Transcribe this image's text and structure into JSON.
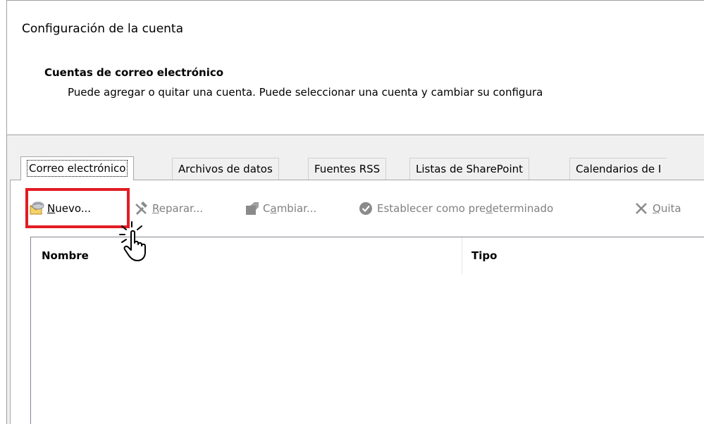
{
  "window": {
    "title": "Configuración de la cuenta"
  },
  "header": {
    "section_title": "Cuentas de correo electrónico",
    "description": "Puede agregar o quitar una cuenta. Puede seleccionar una cuenta y cambiar su configura"
  },
  "tabs": [
    {
      "label": "Correo electrónico",
      "active": true
    },
    {
      "label": "Archivos de datos"
    },
    {
      "label": "Fuentes RSS"
    },
    {
      "label": "Listas de SharePoint"
    },
    {
      "label": "Calendarios de I"
    }
  ],
  "toolbar": {
    "new": {
      "pre": "",
      "ul": "N",
      "post": "uevo...",
      "icon": "new-account-icon"
    },
    "repair": {
      "pre": "",
      "ul": "R",
      "post": "eparar...",
      "icon": "repair-tools-icon"
    },
    "change": {
      "pre": "C",
      "ul": "a",
      "post": "mbiar...",
      "icon": "change-icon"
    },
    "default": {
      "pre": "Establecer como pre",
      "ul": "d",
      "post": "eterminado",
      "icon": "checkmark-circle-icon"
    },
    "remove": {
      "pre": "",
      "ul": "Q",
      "post": "uita",
      "icon": "close-x-icon"
    }
  },
  "list": {
    "columns": [
      "Nombre",
      "Tipo"
    ],
    "rows": []
  },
  "colors": {
    "highlight": "#e31b23",
    "disabled_text": "#808080"
  }
}
